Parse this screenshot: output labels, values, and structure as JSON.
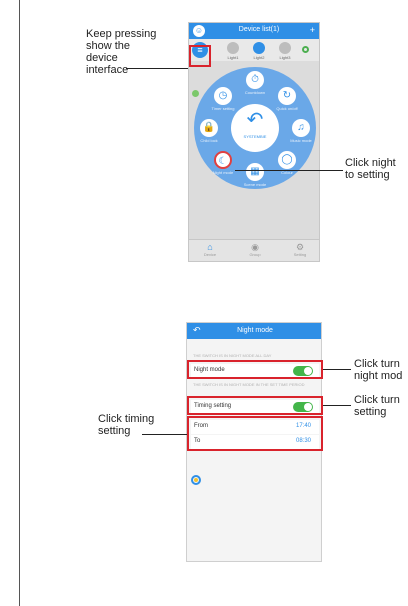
{
  "annotations": {
    "keep_pressing": [
      "Keep pressing",
      "show the",
      "device",
      "interface"
    ],
    "click_night": [
      "Click night",
      "to setting"
    ],
    "click_turn_night": [
      "Click turn",
      "night mod"
    ],
    "click_turn_setting": [
      "Click turn",
      "setting"
    ],
    "click_timing": [
      "Click timing",
      "setting"
    ]
  },
  "screen1": {
    "title": "Device list(1)",
    "bulbs": [
      "Light1",
      "Light2",
      "Light3"
    ],
    "center_label": "SYSTEMBIE",
    "wheel_labels": [
      "Timer setting",
      "Countdown",
      "Quick on/off",
      "Child lock",
      "Music mode",
      "Night mode",
      "Scene mode",
      "Colour"
    ],
    "nav": [
      "Device",
      "Group",
      "Setting"
    ]
  },
  "screen2": {
    "title": "Night mode",
    "note1": "THE SWITCH IS IN NIGHT MODE ALL DAY",
    "night_mode_label": "Night mode",
    "note2": "THE SWITCH IS IN NIGHT MODE IN THE SET TIME PERIOD",
    "timing_label": "Timing setting",
    "from_label": "From",
    "from_time": "17:40",
    "to_label": "To",
    "to_time": "08:30",
    "night_mode_on": true,
    "timing_on": true
  },
  "colors": {
    "accent": "#2f8fe6",
    "highlight": "#d9232c",
    "toggle": "#43b549"
  }
}
